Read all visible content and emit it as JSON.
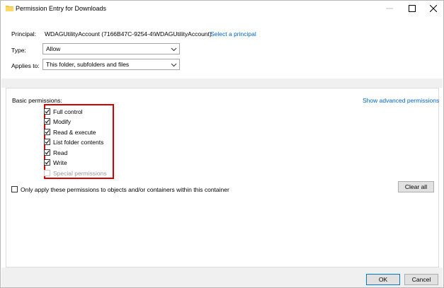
{
  "window": {
    "title": "Permission Entry for Downloads"
  },
  "principal": {
    "label": "Principal:",
    "value": "WDAGUtilityAccount (7166B47C-9254-4\\WDAGUtilityAccount)",
    "select_link": "Select a principal"
  },
  "type": {
    "label": "Type:",
    "value": "Allow"
  },
  "applies_to": {
    "label": "Applies to:",
    "value": "This folder, subfolders and files"
  },
  "permissions": {
    "heading": "Basic permissions:",
    "advanced_link": "Show advanced permissions",
    "items": [
      {
        "label": "Full control",
        "checked": true,
        "enabled": true
      },
      {
        "label": "Modify",
        "checked": true,
        "enabled": true
      },
      {
        "label": "Read & execute",
        "checked": true,
        "enabled": true
      },
      {
        "label": "List folder contents",
        "checked": true,
        "enabled": true
      },
      {
        "label": "Read",
        "checked": true,
        "enabled": true
      },
      {
        "label": "Write",
        "checked": true,
        "enabled": true
      },
      {
        "label": "Special permissions",
        "checked": false,
        "enabled": false
      }
    ],
    "only_apply_label": "Only apply these permissions to objects and/or containers within this container",
    "only_apply_checked": false,
    "clear_all": "Clear all"
  },
  "buttons": {
    "ok": "OK",
    "cancel": "Cancel"
  },
  "colors": {
    "highlight": "#d40000",
    "link": "#0066cc",
    "folder": "#f5c542"
  }
}
